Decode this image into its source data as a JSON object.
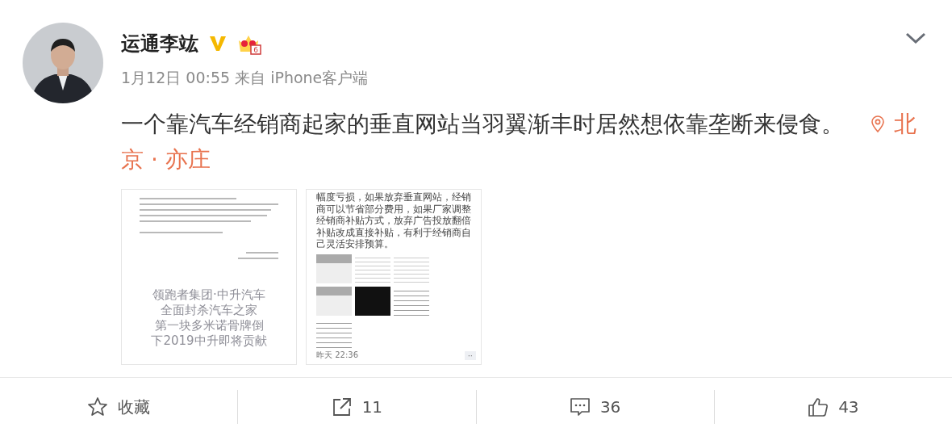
{
  "author": {
    "name": "运通李竑",
    "verified": true,
    "vip_level": "6"
  },
  "meta": "1月12日 00:55 来自 iPhone客户端",
  "post": {
    "text": "一个靠汽车经销商起家的垂直网站当羽翼渐丰时居然想依靠垄断来侵食。",
    "location": [
      "北",
      "京 · 亦庄"
    ]
  },
  "images": [
    {
      "kind": "letter",
      "headline": [
        "领跑者集团·中升汽车",
        "全面封杀汽车之家",
        "第一块多米诺骨牌倒",
        "下2019中升即将贡献"
      ]
    },
    {
      "kind": "chat",
      "paragraph": "幅度亏损，如果放弃垂直网站，经销商可以节省部分费用，如果厂家调整经销商补贴方式，放弃广告投放翻倍补贴改成直接补贴，有利于经销商自己灵活安排预算。",
      "time": "昨天 22:36",
      "more": "··"
    }
  ],
  "actions": [
    {
      "kind": "favorite",
      "label": "收藏"
    },
    {
      "kind": "repost",
      "label": "11"
    },
    {
      "kind": "comment",
      "label": "36"
    },
    {
      "kind": "like",
      "label": "43"
    }
  ]
}
